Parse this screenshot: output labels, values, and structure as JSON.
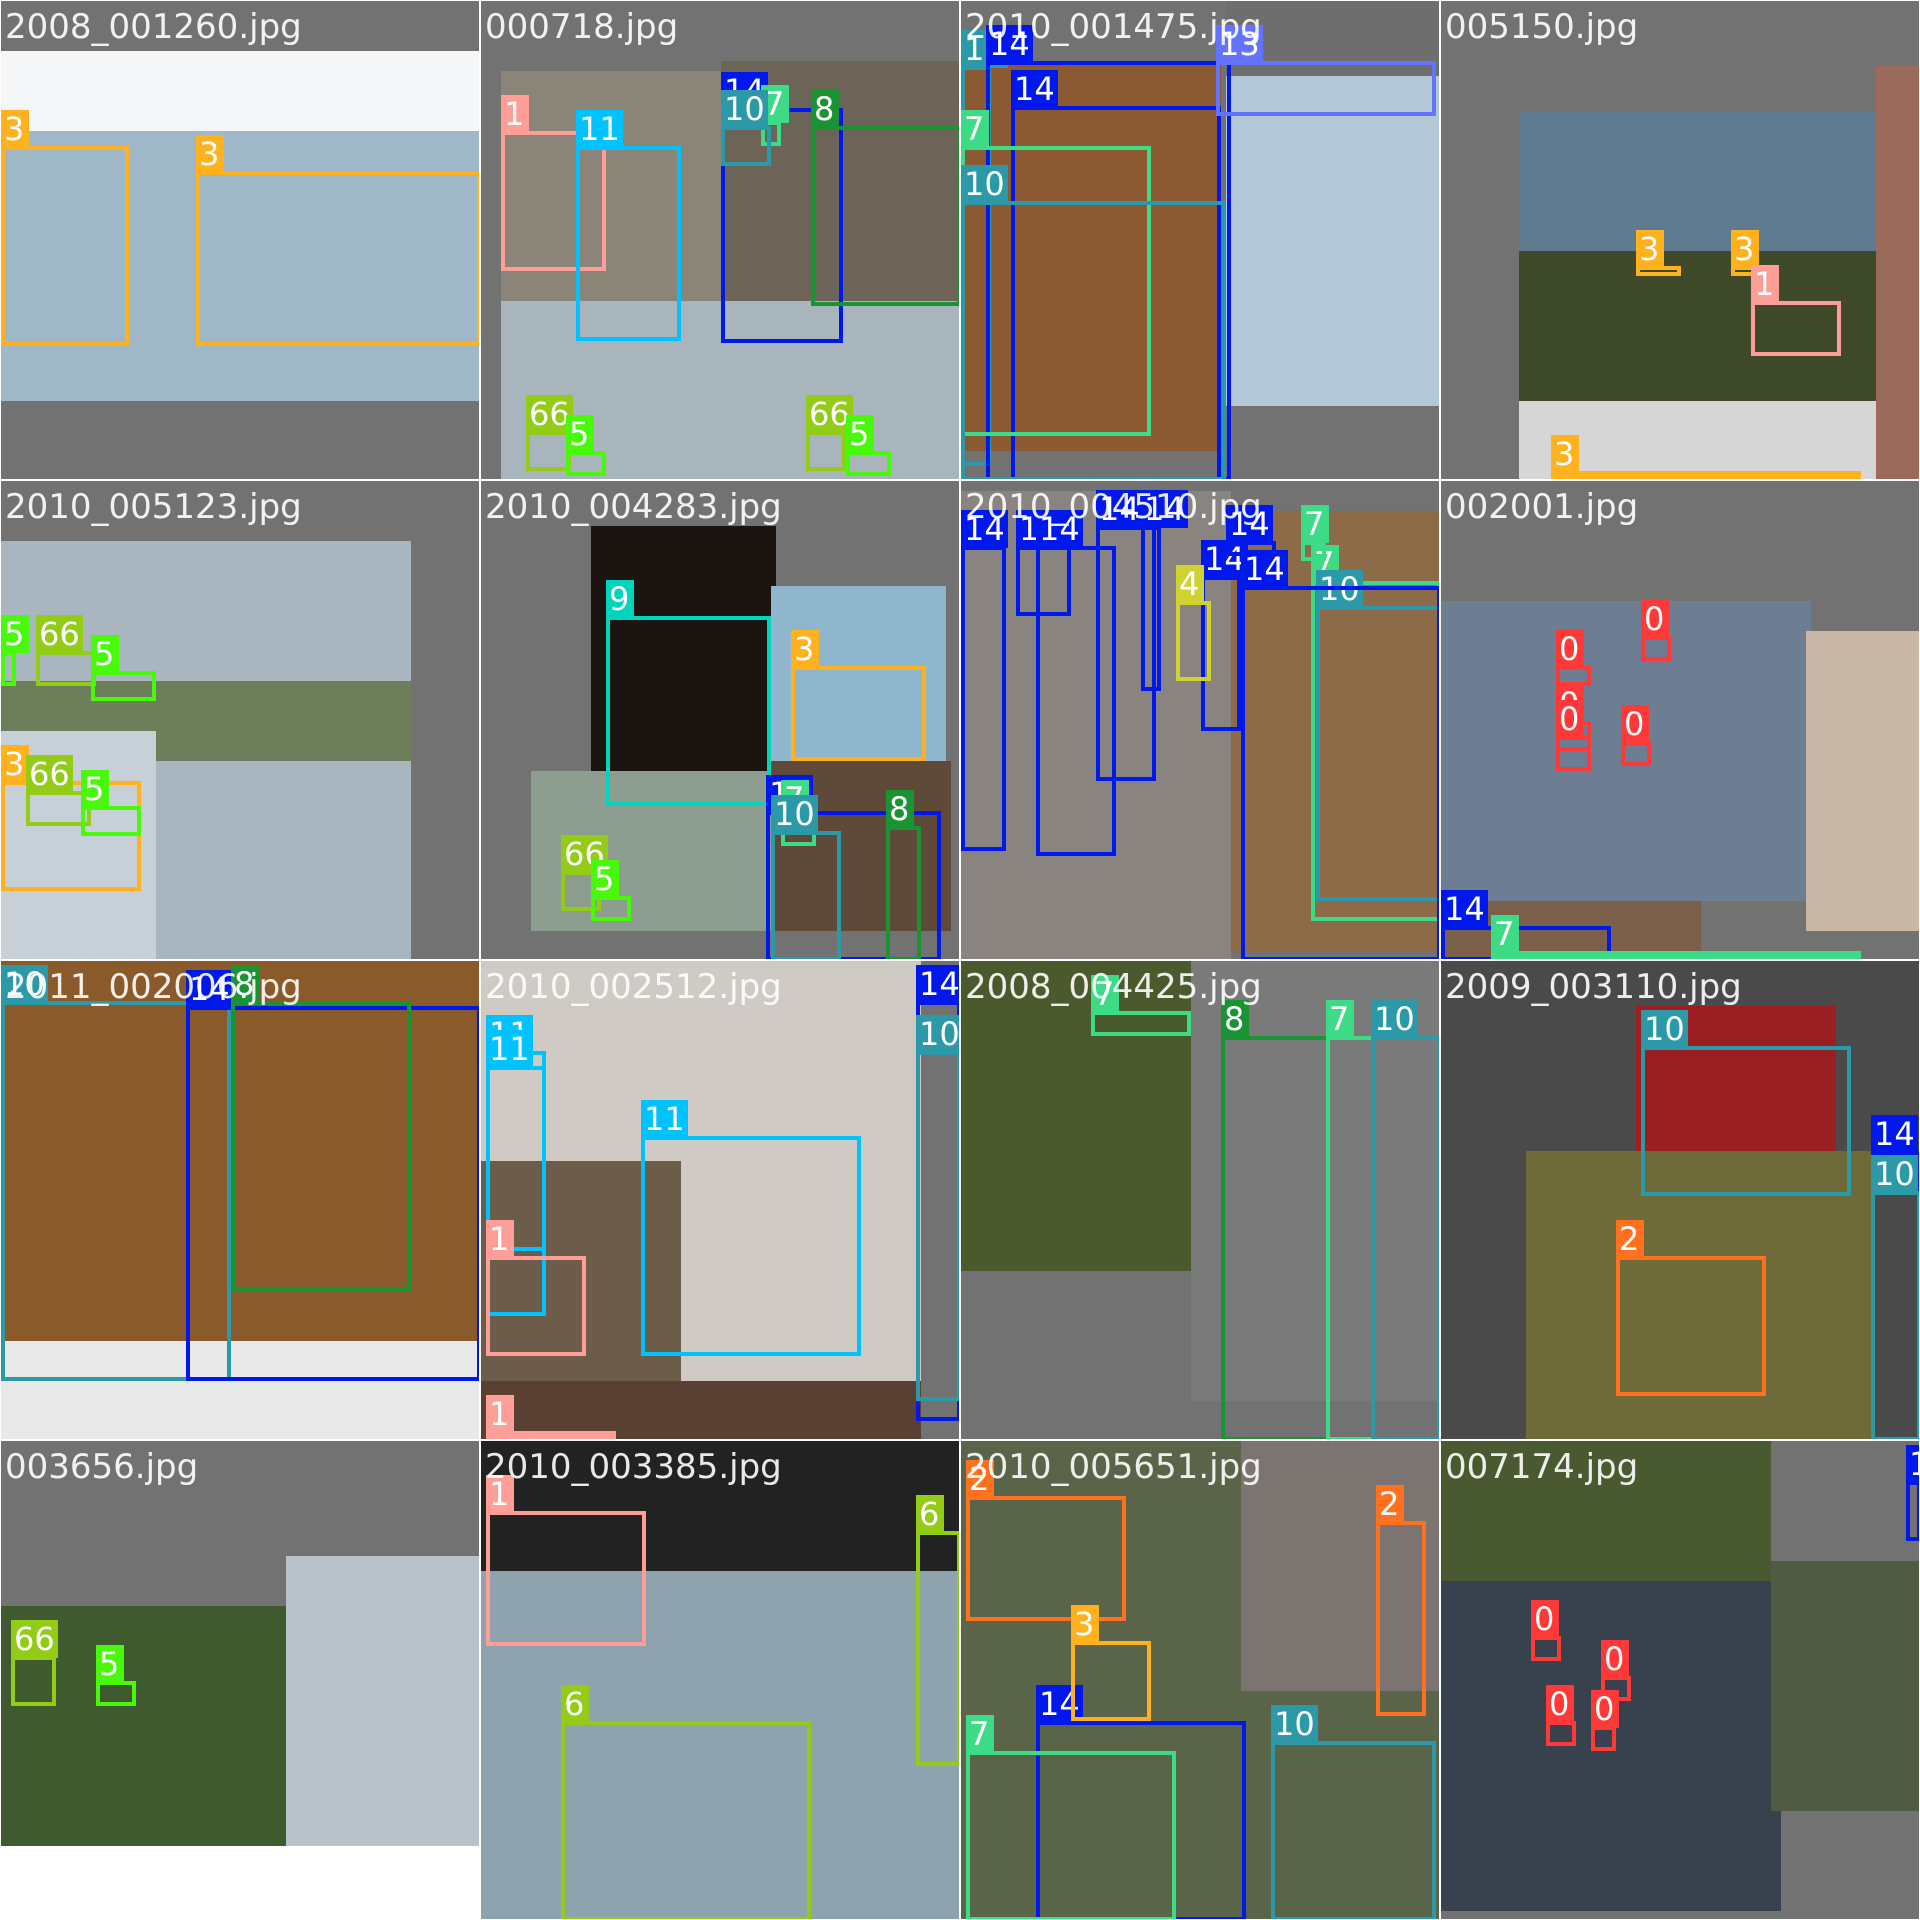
{
  "palette": {
    "0": "#ff3838",
    "1": "#ff9d97",
    "2": "#ff701f",
    "3": "#ffb21d",
    "4": "#cfd231",
    "5": "#48f90a",
    "6": "#92cc17",
    "7": "#3ddb86",
    "8": "#1a9334",
    "9": "#00d4bb",
    "10": "#2c99a8",
    "11": "#00c2ff",
    "13": "#6473ff",
    "14": "#0018ec"
  },
  "tiles": [
    {
      "caption": "2008_001260.jpg",
      "regions": [
        [
          "#9fb8c8",
          0,
          50,
          480,
          350
        ],
        [
          "#f4f6f8",
          0,
          50,
          480,
          80
        ]
      ],
      "boxes": [
        {
          "label": "3",
          "cls": "3"
        },
        {
          "label": "3",
          "cls": "3"
        }
      ]
    },
    {
      "caption": "000718.jpg",
      "regions": [
        [
          "#8b8478",
          20,
          70,
          220,
          230
        ],
        [
          "#6d6458",
          240,
          60,
          240,
          240
        ],
        [
          "#a9b5bd",
          20,
          300,
          460,
          180
        ]
      ],
      "boxes": [
        {
          "label": "1",
          "cls": "1"
        },
        {
          "label": "11",
          "cls": "11"
        },
        {
          "label": "14",
          "cls": "14"
        },
        {
          "label": "7",
          "cls": "7"
        },
        {
          "label": "10",
          "cls": "10"
        },
        {
          "label": "8",
          "cls": "8"
        },
        {
          "label": "66",
          "cls": "6"
        },
        {
          "label": "5",
          "cls": "5"
        },
        {
          "label": "66",
          "cls": "6"
        },
        {
          "label": "5",
          "cls": "5"
        }
      ]
    },
    {
      "caption": "2010_001475.jpg",
      "regions": [
        [
          "#8c5a32",
          0,
          60,
          260,
          390
        ],
        [
          "#b3c7d6",
          265,
          75,
          215,
          330
        ],
        [
          "#6e6e6e",
          265,
          0,
          215,
          75
        ]
      ],
      "boxes": [
        {
          "label": "10",
          "cls": "10"
        },
        {
          "label": "14",
          "cls": "14"
        },
        {
          "label": "14",
          "cls": "14"
        },
        {
          "label": "13",
          "cls": "13"
        },
        {
          "label": "7",
          "cls": "7"
        },
        {
          "label": "10",
          "cls": "10"
        }
      ]
    },
    {
      "caption": "005150.jpg",
      "regions": [
        [
          "#607a8f",
          78,
          110,
          360,
          290
        ],
        [
          "#3f4a2a",
          78,
          250,
          360,
          150
        ],
        [
          "#d6d6d6",
          78,
          400,
          360,
          80
        ],
        [
          "#9b6a5a",
          435,
          65,
          45,
          415
        ]
      ],
      "boxes": [
        {
          "label": "3",
          "cls": "3"
        },
        {
          "label": "3",
          "cls": "3"
        },
        {
          "label": "1",
          "cls": "1"
        },
        {
          "label": "3",
          "cls": "3"
        }
      ]
    },
    {
      "caption": "2010_005123.jpg",
      "regions": [
        [
          "#aab6bf",
          0,
          60,
          410,
          420
        ],
        [
          "#6d7f5a",
          0,
          200,
          410,
          80
        ],
        [
          "#c7d0d6",
          0,
          250,
          155,
          230
        ]
      ],
      "boxes": [
        {
          "label": "5",
          "cls": "5"
        },
        {
          "label": "66",
          "cls": "6"
        },
        {
          "label": "5",
          "cls": "5"
        },
        {
          "label": "3",
          "cls": "3"
        },
        {
          "label": "66",
          "cls": "6"
        },
        {
          "label": "5",
          "cls": "5"
        }
      ]
    },
    {
      "caption": "2010_004283.jpg",
      "regions": [
        [
          "#1b1410",
          110,
          45,
          185,
          290
        ],
        [
          "#8fb6cc",
          290,
          105,
          175,
          180
        ],
        [
          "#8d9d8f",
          50,
          290,
          245,
          160
        ],
        [
          "#5f4a3a",
          290,
          280,
          180,
          170
        ]
      ],
      "boxes": [
        {
          "label": "9",
          "cls": "9"
        },
        {
          "label": "3",
          "cls": "3"
        },
        {
          "label": "14",
          "cls": "14"
        },
        {
          "label": "7",
          "cls": "7"
        },
        {
          "label": "10",
          "cls": "10"
        },
        {
          "label": "8",
          "cls": "8"
        },
        {
          "label": "66",
          "cls": "6"
        },
        {
          "label": "5",
          "cls": "5"
        }
      ]
    },
    {
      "caption": "2010_004510.jpg",
      "regions": [
        [
          "#8a8480",
          0,
          10,
          270,
          470
        ],
        [
          "#8d6a48",
          270,
          30,
          210,
          440
        ]
      ],
      "boxes": [
        {
          "label": "14",
          "cls": "14"
        },
        {
          "label": "14",
          "cls": "14"
        },
        {
          "label": "14",
          "cls": "14"
        },
        {
          "label": "14",
          "cls": "14"
        },
        {
          "label": "14",
          "cls": "14"
        },
        {
          "label": "14",
          "cls": "14"
        },
        {
          "label": "4",
          "cls": "4"
        },
        {
          "label": "14",
          "cls": "14"
        },
        {
          "label": "7",
          "cls": "7"
        },
        {
          "label": "10",
          "cls": "10"
        },
        {
          "label": "14",
          "cls": "14"
        },
        {
          "label": "7",
          "cls": "7"
        }
      ]
    },
    {
      "caption": "002001.jpg",
      "regions": [
        [
          "#6e7e92",
          0,
          120,
          370,
          300
        ],
        [
          "#c9b7a6",
          365,
          150,
          115,
          300
        ],
        [
          "#7a5f4b",
          0,
          420,
          260,
          60
        ]
      ],
      "boxes": [
        {
          "label": "0",
          "cls": "0"
        },
        {
          "label": "0",
          "cls": "0"
        },
        {
          "label": "0",
          "cls": "0"
        },
        {
          "label": "0",
          "cls": "0"
        },
        {
          "label": "0",
          "cls": "0"
        },
        {
          "label": "14",
          "cls": "14"
        },
        {
          "label": "7",
          "cls": "7"
        }
      ]
    },
    {
      "caption": "2011_002006.jpg",
      "regions": [
        [
          "#8b5a2b",
          0,
          0,
          480,
          380
        ],
        [
          "#e9e9e9",
          0,
          380,
          480,
          100
        ]
      ],
      "boxes": [
        {
          "label": "10",
          "cls": "10"
        },
        {
          "label": "14",
          "cls": "14"
        },
        {
          "label": "8",
          "cls": "8"
        }
      ]
    },
    {
      "caption": "2010_002512.jpg",
      "regions": [
        [
          "#cfcac4",
          0,
          0,
          440,
          420
        ],
        [
          "#6c5c4a",
          0,
          200,
          200,
          220
        ],
        [
          "#5a4032",
          0,
          420,
          440,
          60
        ]
      ],
      "boxes": [
        {
          "label": "11",
          "cls": "11"
        },
        {
          "label": "11",
          "cls": "11"
        },
        {
          "label": "11",
          "cls": "11"
        },
        {
          "label": "1",
          "cls": "1"
        },
        {
          "label": "1",
          "cls": "1"
        },
        {
          "label": "14",
          "cls": "14"
        },
        {
          "label": "10",
          "cls": "10"
        }
      ]
    },
    {
      "caption": "2008_004425.jpg",
      "regions": [
        [
          "#4b5a2c",
          0,
          0,
          230,
          310
        ],
        [
          "#7b7a7a",
          230,
          0,
          250,
          440
        ]
      ],
      "boxes": [
        {
          "label": "7",
          "cls": "7"
        },
        {
          "label": "8",
          "cls": "8"
        },
        {
          "label": "7",
          "cls": "7"
        },
        {
          "label": "10",
          "cls": "10"
        }
      ]
    },
    {
      "caption": "2009_003110.jpg",
      "regions": [
        [
          "#4a4a4a",
          0,
          0,
          480,
          480
        ],
        [
          "#9b1f22",
          195,
          45,
          200,
          150
        ],
        [
          "#6f6a3a",
          85,
          190,
          345,
          290
        ]
      ],
      "boxes": [
        {
          "label": "10",
          "cls": "10"
        },
        {
          "label": "14",
          "cls": "14"
        },
        {
          "label": "10",
          "cls": "10"
        },
        {
          "label": "2",
          "cls": "2"
        }
      ]
    },
    {
      "caption": "003656.jpg",
      "regions": [
        [
          "#3f5a2e",
          0,
          165,
          285,
          240
        ],
        [
          "#b8c2c9",
          285,
          115,
          195,
          295
        ],
        [
          "#ffffff",
          0,
          405,
          480,
          75
        ]
      ],
      "boxes": [
        {
          "label": "66",
          "cls": "6"
        },
        {
          "label": "5",
          "cls": "5"
        }
      ]
    },
    {
      "caption": "2010_003385.jpg",
      "regions": [
        [
          "#222222",
          0,
          0,
          480,
          140
        ],
        [
          "#8ea3ad",
          0,
          130,
          480,
          350
        ]
      ],
      "boxes": [
        {
          "label": "1",
          "cls": "1"
        },
        {
          "label": "6",
          "cls": "6"
        },
        {
          "label": "6",
          "cls": "6"
        }
      ]
    },
    {
      "caption": "2010_005651.jpg",
      "regions": [
        [
          "#5a6448",
          0,
          0,
          480,
          480
        ],
        [
          "#7c7470",
          280,
          0,
          200,
          250
        ]
      ],
      "boxes": [
        {
          "label": "2",
          "cls": "2"
        },
        {
          "label": "2",
          "cls": "2"
        },
        {
          "label": "14",
          "cls": "14"
        },
        {
          "label": "7",
          "cls": "7"
        },
        {
          "label": "10",
          "cls": "10"
        },
        {
          "label": "3",
          "cls": "3"
        }
      ]
    },
    {
      "caption": "007174.jpg",
      "regions": [
        [
          "#4a5a30",
          0,
          0,
          330,
          140
        ],
        [
          "#38424e",
          0,
          140,
          340,
          330
        ],
        [
          "#4f5b45",
          330,
          120,
          150,
          250
        ]
      ],
      "boxes": [
        {
          "label": "0",
          "cls": "0"
        },
        {
          "label": "0",
          "cls": "0"
        },
        {
          "label": "0",
          "cls": "0"
        },
        {
          "label": "0",
          "cls": "0"
        },
        {
          "label": "1",
          "cls": "14"
        }
      ]
    }
  ]
}
